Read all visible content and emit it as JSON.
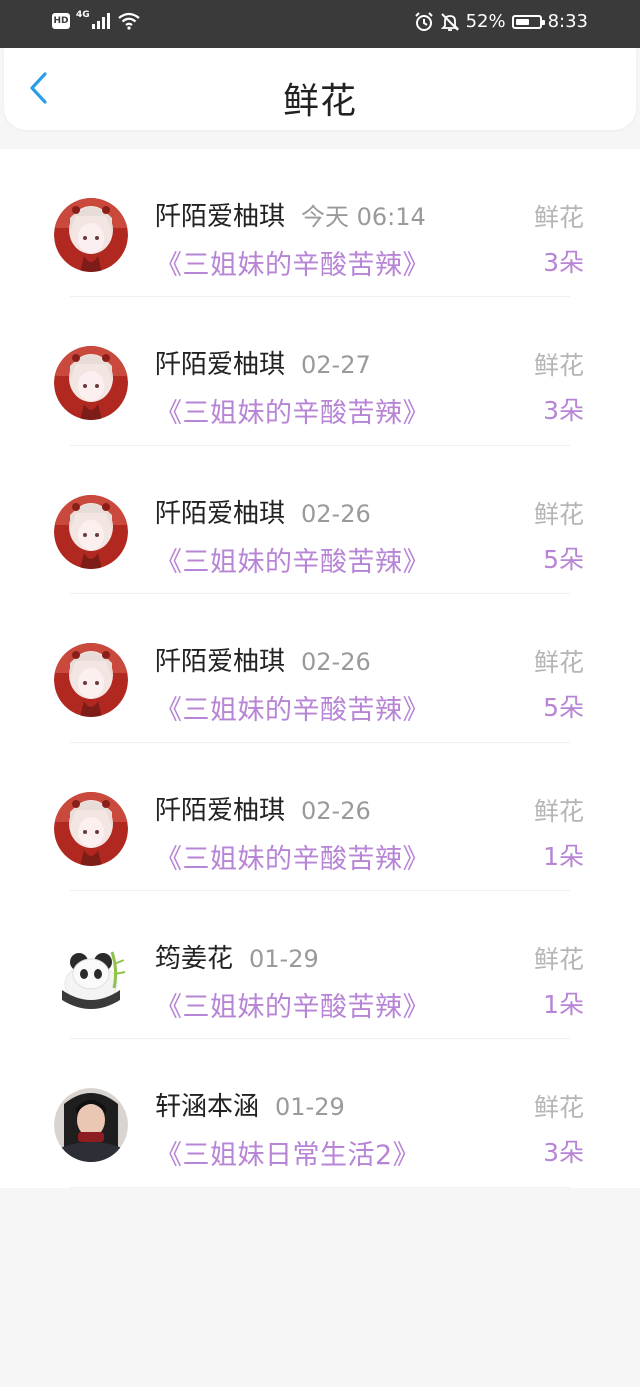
{
  "status_bar": {
    "hd": "HD",
    "network": "4G",
    "battery": "52%",
    "time": "8:33"
  },
  "header": {
    "title": "鲜花"
  },
  "gifts": [
    {
      "user": "阡陌爱柚琪",
      "time": "今天 06:14",
      "book": "《三姐妹的辛酸苦辣》",
      "type": "鲜花",
      "count": "3朵"
    },
    {
      "user": "阡陌爱柚琪",
      "time": "02-27",
      "book": "《三姐妹的辛酸苦辣》",
      "type": "鲜花",
      "count": "3朵"
    },
    {
      "user": "阡陌爱柚琪",
      "time": "02-26",
      "book": "《三姐妹的辛酸苦辣》",
      "type": "鲜花",
      "count": "5朵"
    },
    {
      "user": "阡陌爱柚琪",
      "time": "02-26",
      "book": "《三姐妹的辛酸苦辣》",
      "type": "鲜花",
      "count": "5朵"
    },
    {
      "user": "阡陌爱柚琪",
      "time": "02-26",
      "book": "《三姐妹的辛酸苦辣》",
      "type": "鲜花",
      "count": "1朵"
    },
    {
      "user": "筠姜花",
      "time": "01-29",
      "book": "《三姐妹的辛酸苦辣》",
      "type": "鲜花",
      "count": "1朵"
    },
    {
      "user": "轩涵本涵",
      "time": "01-29",
      "book": "《三姐妹日常生活2》",
      "type": "鲜花",
      "count": "3朵"
    }
  ],
  "colors": {
    "accent": "#b784d6",
    "back_icon": "#2a9fe6"
  }
}
